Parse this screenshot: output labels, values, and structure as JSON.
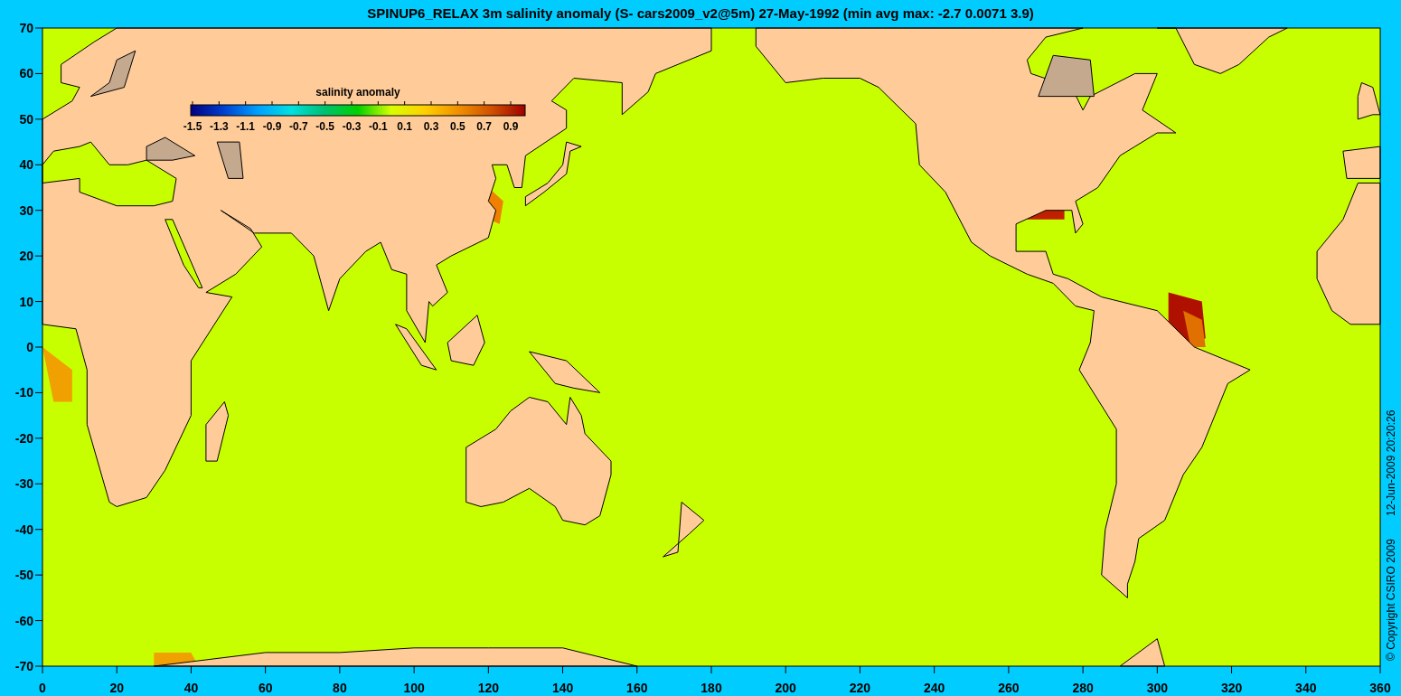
{
  "title": "SPINUP6_RELAX 3m salinity anomaly (S- cars2009_v2@5m) 27-May-1992 (min avg max: -2.7 0.0071 3.9)",
  "colorbar": {
    "title": "salinity anomaly",
    "tick_labels": [
      "-1.5",
      "-1.3",
      "-1.1",
      "-0.9",
      "-0.7",
      "-0.5",
      "-0.3",
      "-0.1",
      "0.1",
      "0.3",
      "0.5",
      "0.7",
      "0.9"
    ]
  },
  "plot": {
    "y_ticks": [
      "70",
      "60",
      "50",
      "40",
      "30",
      "20",
      "10",
      "0",
      "-10",
      "-20",
      "-30",
      "-40",
      "-50",
      "-60",
      "-70"
    ],
    "x_ticks": [
      "0",
      "20",
      "40",
      "60",
      "80",
      "100",
      "120",
      "140",
      "160",
      "180",
      "200",
      "220",
      "240",
      "260",
      "280",
      "300",
      "320",
      "340",
      "360"
    ]
  },
  "footer": {
    "copyright": "© Copyright CSIRO 2009",
    "timestamp": "12-Jun-2009 20:20:26"
  }
}
